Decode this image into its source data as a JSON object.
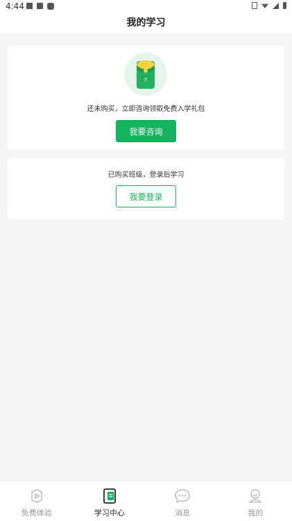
{
  "status_bar": {
    "time": "4:44"
  },
  "header": {
    "title": "我的学习"
  },
  "consult_card": {
    "icon": "red-packet-gift-icon",
    "text": "还未购买，立即咨询领取免费入学礼包",
    "button_label": "我要咨询"
  },
  "login_card": {
    "text": "已购买班级，登录后学习",
    "button_label": "我要登录"
  },
  "tabs": [
    {
      "label": "免费体验",
      "icon": "play-icon",
      "active": false
    },
    {
      "label": "学习中心",
      "icon": "study-book-icon",
      "active": true
    },
    {
      "label": "消息",
      "icon": "message-icon",
      "active": false
    },
    {
      "label": "我的",
      "icon": "profile-icon",
      "active": false
    }
  ],
  "colors": {
    "accent": "#13b35d",
    "background": "#f5f5f5"
  }
}
